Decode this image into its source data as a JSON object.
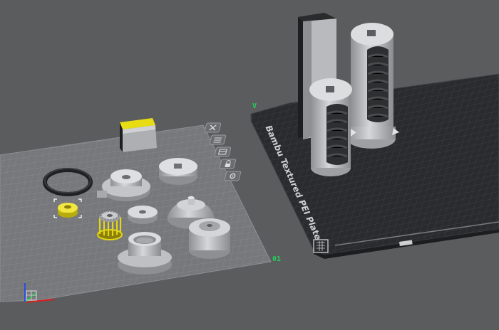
{
  "viewport": {
    "background": "#5b5c5e",
    "plate1": {
      "type": "smooth-grid-plate",
      "grid_color": "#8d8e91",
      "index_label": "01",
      "index_label_color": "#22d05a",
      "toolbar": [
        {
          "name": "close-plate",
          "icon": "close-icon"
        },
        {
          "name": "arrange-plate",
          "icon": "arrange-icon"
        },
        {
          "name": "orient-plate",
          "icon": "orient-icon"
        },
        {
          "name": "lock-plate",
          "icon": "lock-icon"
        },
        {
          "name": "plate-settings",
          "icon": "settings-icon"
        }
      ]
    },
    "plate2": {
      "type": "textured-pei-plate",
      "label": "Bambu Textured PEI Plate",
      "grid_color": "#2d2e31",
      "corner_mark": "V",
      "corner_mark_color": "#22d05a"
    },
    "selection_color": "#f2e312",
    "axes": {
      "x_color": "#d62020",
      "y_color": "#1ac04a",
      "z_color": "#2a4fe0"
    }
  }
}
